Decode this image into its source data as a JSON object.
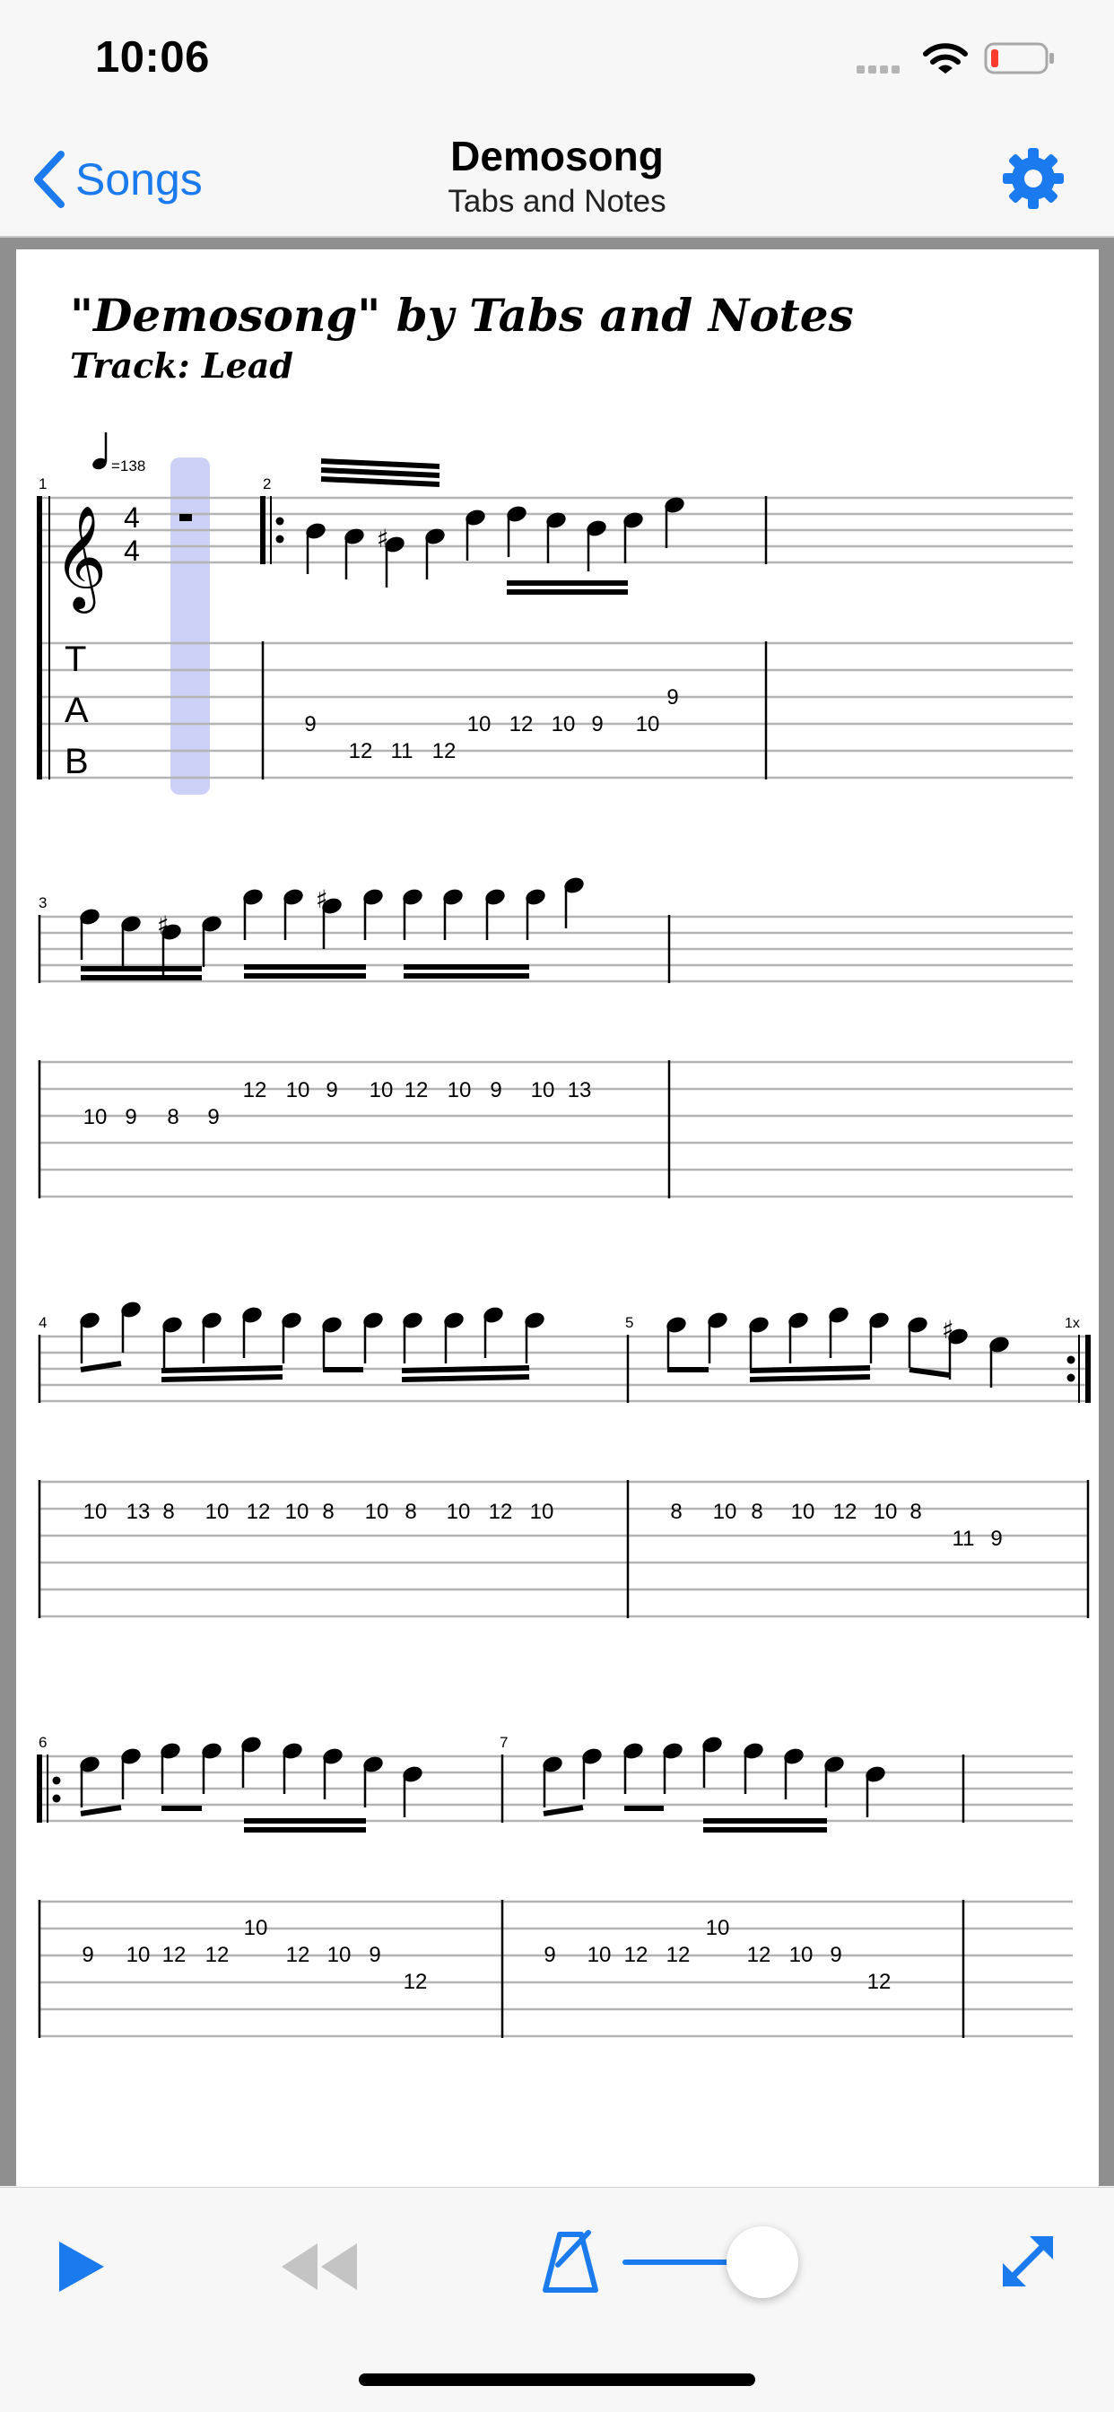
{
  "status_bar": {
    "time": "10:06"
  },
  "nav": {
    "back_label": "Songs",
    "title": "Demosong",
    "subtitle": "Tabs and Notes"
  },
  "score": {
    "title": "\"Demosong\"  by Tabs and Notes",
    "track": "Track: Lead",
    "tempo": "=138",
    "time_signature": {
      "top": "4",
      "bottom": "4"
    },
    "tab_letters": [
      "T",
      "A",
      "B"
    ],
    "repeat_count": "1x",
    "measure_numbers": [
      "1",
      "2",
      "3",
      "4",
      "5",
      "6",
      "7"
    ],
    "tab_fret_labels": [
      "9",
      "12",
      "11",
      "12",
      "10",
      "12",
      "10",
      "9",
      "10",
      "9",
      "10",
      "9",
      "8",
      "9",
      "12",
      "10",
      "9",
      "10",
      "12",
      "10",
      "9",
      "10",
      "13",
      "10",
      "13",
      "8",
      "10",
      "12",
      "10",
      "8",
      "10",
      "8",
      "10",
      "12",
      "10",
      "8",
      "10",
      "8",
      "10",
      "12",
      "10",
      "8",
      "11",
      "9",
      "9",
      "10",
      "12",
      "12",
      "10",
      "12",
      "10",
      "9",
      "12",
      "9",
      "10",
      "12",
      "12",
      "10",
      "12",
      "10",
      "9",
      "12"
    ]
  },
  "toolbar": {
    "playback_position": 0.82
  },
  "colors": {
    "accent": "#1a7aee",
    "highlight": "#cdd0f7",
    "battery": "#ff3b30"
  }
}
